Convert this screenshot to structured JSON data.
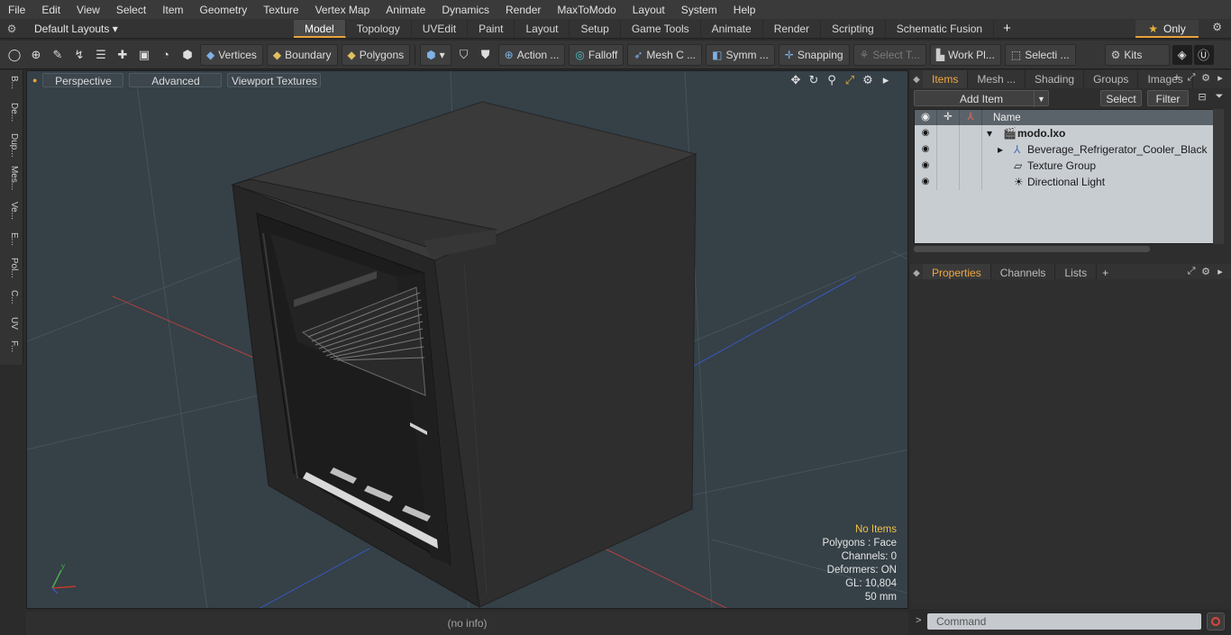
{
  "menu": [
    "File",
    "Edit",
    "View",
    "Select",
    "Item",
    "Geometry",
    "Texture",
    "Vertex Map",
    "Animate",
    "Dynamics",
    "Render",
    "MaxToModo",
    "Layout",
    "System",
    "Help"
  ],
  "layout_bar": {
    "layouts_label": "Default Layouts",
    "tabs": [
      "Model",
      "Topology",
      "UVEdit",
      "Paint",
      "Layout",
      "Setup",
      "Game Tools",
      "Animate",
      "Render",
      "Scripting",
      "Schematic Fusion"
    ],
    "active_tab": "Model",
    "only_label": "Only",
    "plus": "+"
  },
  "toolbar": {
    "vertices": "Vertices",
    "boundary": "Boundary",
    "polygons": "Polygons",
    "action": "Action ...",
    "falloff": "Falloff",
    "mesh": "Mesh C ...",
    "symm": "Symm ...",
    "snapping": "Snapping",
    "select_t": "Select T...",
    "work_pl": "Work Pl...",
    "selecti": "Selecti ...",
    "kits": "Kits"
  },
  "left_tabs": [
    "B...",
    "De...",
    "Dup...",
    "Mes...",
    "Ve...",
    "E...",
    "Pol...",
    "C...",
    "UV",
    "F..."
  ],
  "viewport": {
    "perspective": "Perspective",
    "advanced": "Advanced",
    "textures": "Viewport Textures",
    "stats": {
      "no_items": "No Items",
      "polygons": "Polygons : Face",
      "channels": "Channels: 0",
      "deformers": "Deformers: ON",
      "gl": "GL: 10,804",
      "scale": "50 mm"
    },
    "status": "(no info)",
    "colors": {
      "background": "#354047",
      "grid": "#4a555c",
      "x_axis": "#b5423f",
      "z_axis": "#3a57b8",
      "object": "#333333"
    }
  },
  "items_panel": {
    "tabs": [
      "Items",
      "Mesh ...",
      "Shading",
      "Groups",
      "Images"
    ],
    "active_tab": "Items",
    "add_item": "Add Item",
    "select": "Select",
    "filter": "Filter",
    "name_header": "Name",
    "tree": [
      {
        "label": "modo.lxo",
        "bold": true
      },
      {
        "label": "Beverage_Refrigerator_Cooler_Black",
        "bold": false
      },
      {
        "label": "Texture Group",
        "bold": false
      },
      {
        "label": "Directional Light",
        "bold": false
      }
    ]
  },
  "properties_panel": {
    "tabs": [
      "Properties",
      "Channels",
      "Lists"
    ],
    "active_tab": "Properties"
  },
  "command": {
    "placeholder": "Command"
  }
}
